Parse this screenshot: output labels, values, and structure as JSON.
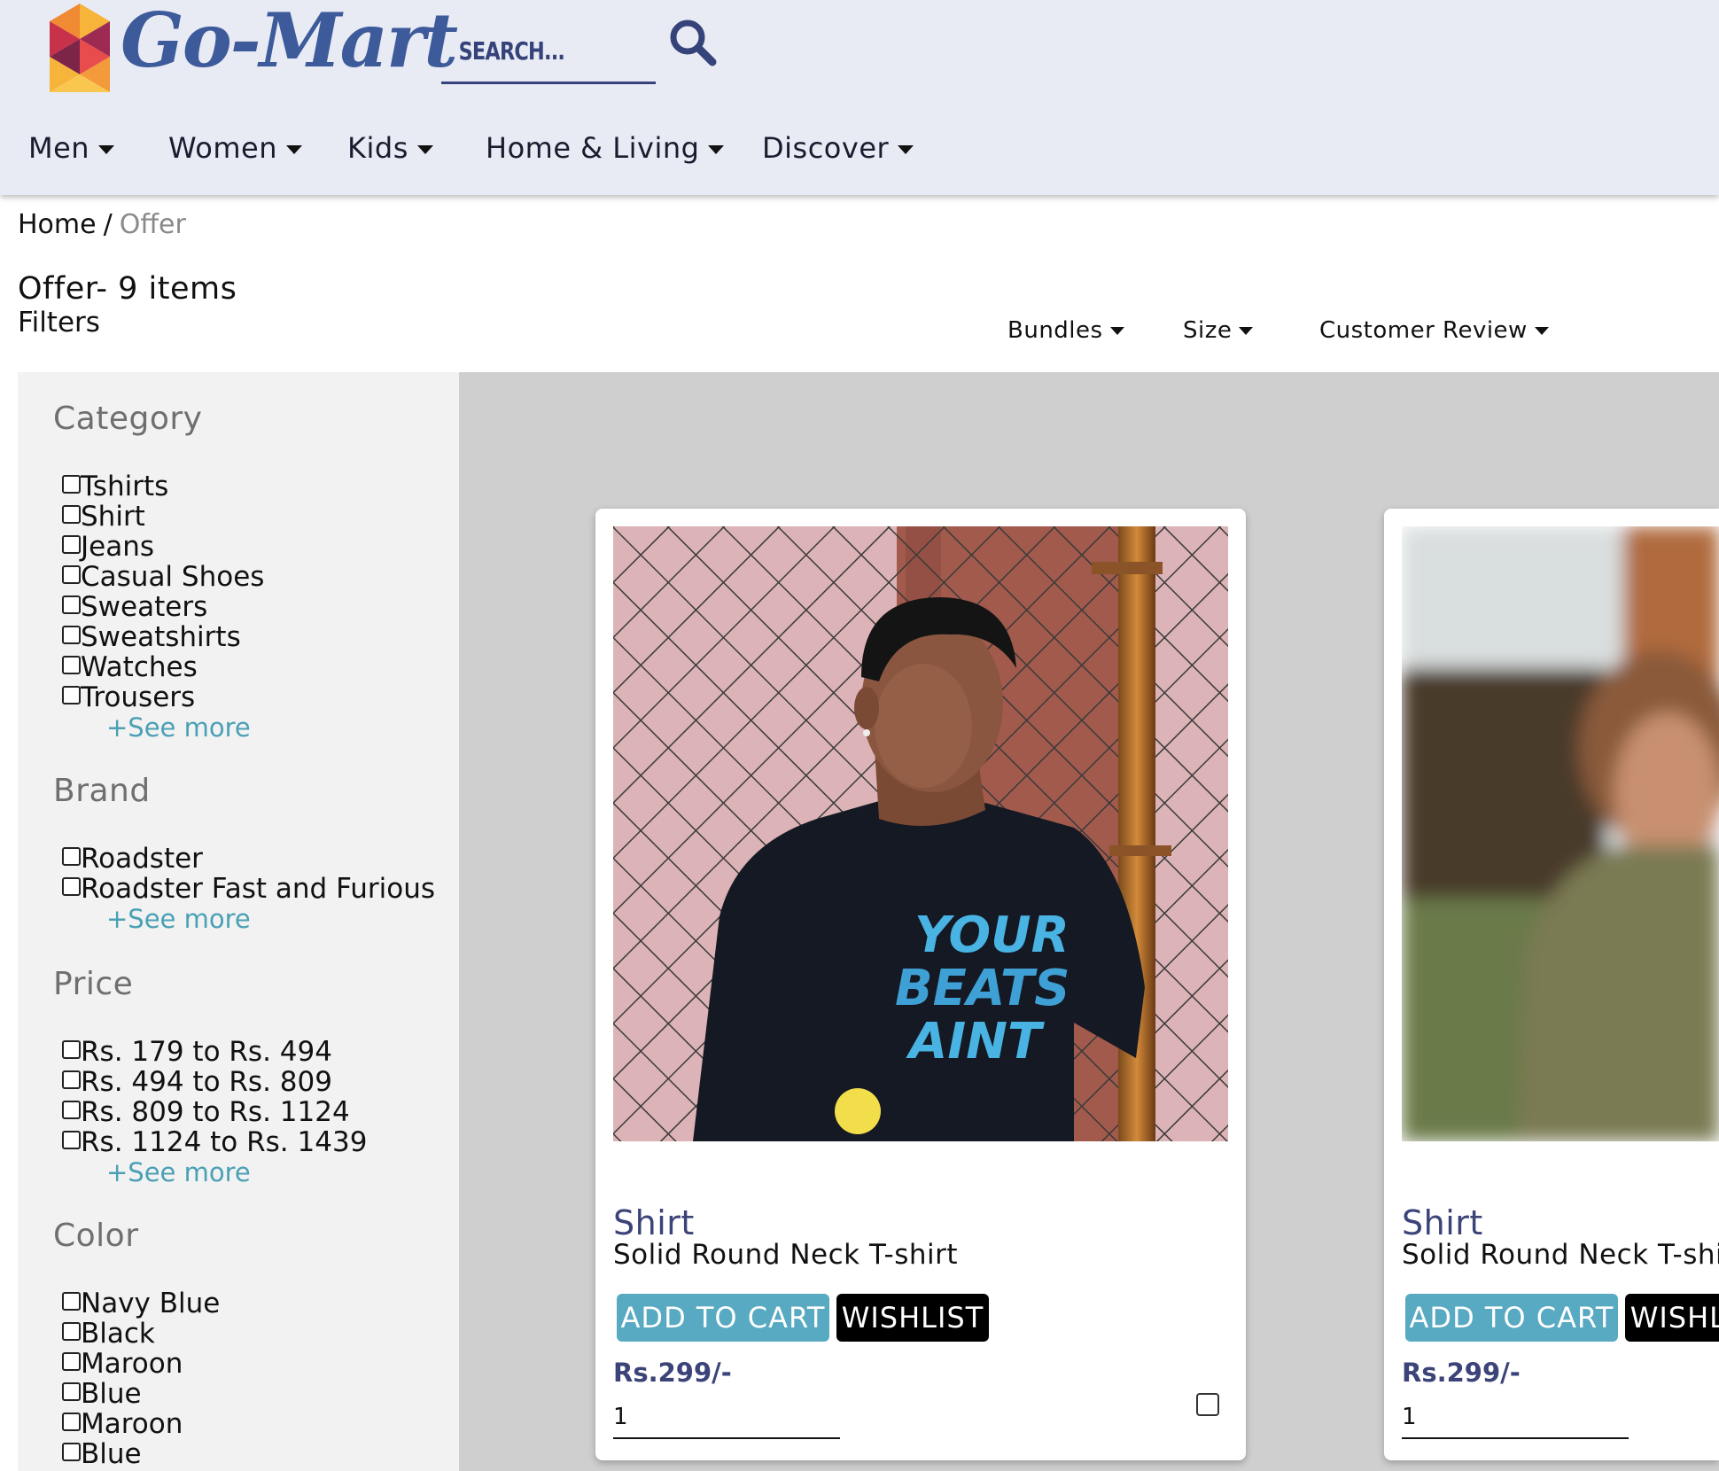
{
  "header": {
    "brand": "Go-Mart",
    "search_placeholder": "SEARCH...",
    "nav": [
      "Men",
      "Women",
      "Kids",
      "Home & Living",
      "Discover"
    ]
  },
  "breadcrumb": {
    "home": "Home",
    "separator": "/",
    "current": "Offer"
  },
  "page": {
    "title": "Offer- 9 items",
    "filters_label": "Filters"
  },
  "sort_options": [
    "Bundles",
    "Size",
    "Customer Review"
  ],
  "sidebar": {
    "category": {
      "title": "Category",
      "options": [
        "Tshirts",
        "Shirt",
        "Jeans",
        "Casual Shoes",
        "Sweaters",
        "Sweatshirts",
        "Watches",
        "Trousers"
      ],
      "see_more": "+See more"
    },
    "brand": {
      "title": "Brand",
      "options": [
        "Roadster",
        "Roadster Fast and Furious"
      ],
      "see_more": "+See more"
    },
    "price": {
      "title": "Price",
      "options": [
        "Rs. 179 to Rs. 494",
        "Rs. 494 to Rs. 809",
        "Rs. 809 to Rs. 1124",
        "Rs. 1124 to Rs. 1439"
      ],
      "see_more": "+See more"
    },
    "color": {
      "title": "Color",
      "options": [
        "Navy Blue",
        "Black",
        "Maroon",
        "Blue",
        "Maroon",
        "Blue"
      ]
    }
  },
  "products": [
    {
      "type": "Shirt",
      "name": "Solid Round Neck T-shirt",
      "add_to_cart": "ADD TO CART",
      "wishlist": "WISHLIST",
      "price": "Rs.299/-",
      "quantity": "1",
      "tshirt_print": [
        "YOUR",
        "BEATS",
        "AINT"
      ]
    },
    {
      "type": "Shirt",
      "name": "Solid Round Neck T-shirt",
      "add_to_cart": "ADD TO CART",
      "wishlist": "WISHLIST",
      "price": "Rs.299/-",
      "quantity": "1"
    }
  ],
  "colors": {
    "header_bg": "#e8ebf4",
    "brand": "#3d5a9b",
    "accent": "#58a9c2",
    "product_type": "#3b4378",
    "link": "#4aa0b5"
  }
}
